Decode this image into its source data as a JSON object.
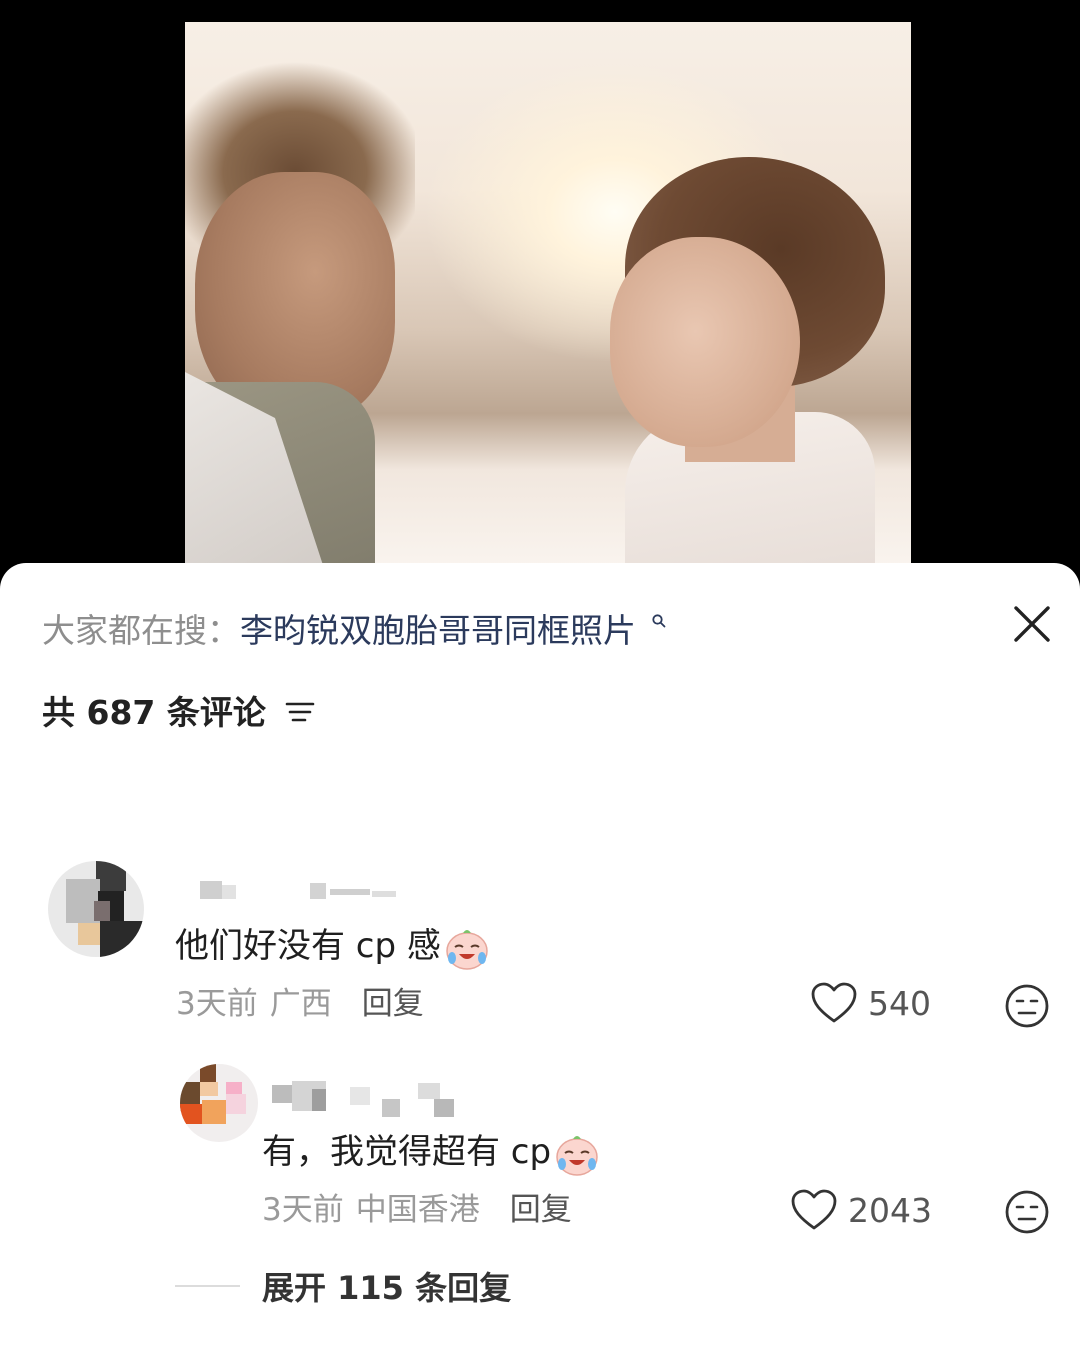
{
  "search": {
    "prefix": "大家都在搜：",
    "term": "李昀锐双胞胎哥哥同框照片",
    "icon": "search-icon"
  },
  "comments_header": {
    "label": "共 687 条评论",
    "sort_icon": "sort-icon"
  },
  "comments": [
    {
      "text": "他们好没有 cp 感",
      "emoji": "crying-laughing-emoji",
      "time": "3天前",
      "location": "广西",
      "reply_label": "回复",
      "likes": "540"
    },
    {
      "text": "有，我觉得超有 cp",
      "emoji": "crying-laughing-emoji",
      "time": "3天前",
      "location": "中国香港",
      "reply_label": "回复",
      "likes": "2043"
    }
  ],
  "expand_replies": "展开 115 条回复",
  "colors": {
    "search_term": "#2b3a5c",
    "meta_text": "#9a9a9a",
    "background_top": "#000000"
  }
}
